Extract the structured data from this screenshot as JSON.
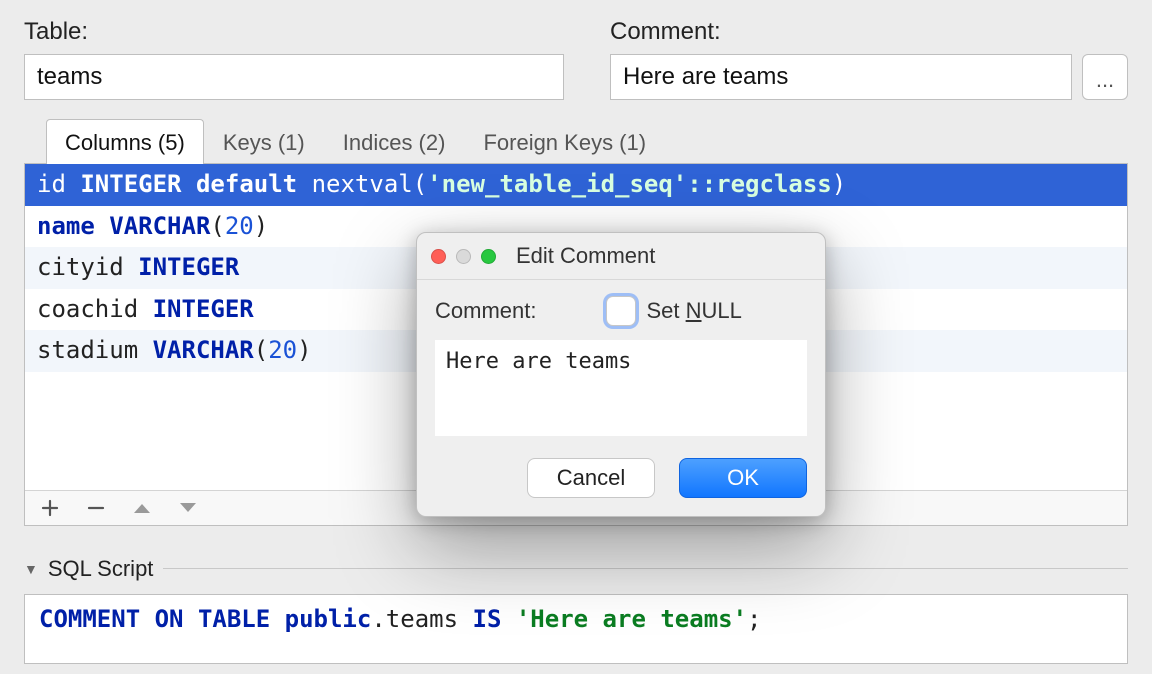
{
  "top": {
    "table_label": "Table:",
    "table_value": "teams",
    "comment_label": "Comment:",
    "comment_value": "Here are teams",
    "ellipsis": "..."
  },
  "tabs": [
    {
      "label": "Columns (5)",
      "active": true
    },
    {
      "label": "Keys (1)",
      "active": false
    },
    {
      "label": "Indices (2)",
      "active": false
    },
    {
      "label": "Foreign Keys (1)",
      "active": false
    }
  ],
  "columns": [
    {
      "name": "id",
      "type": "INTEGER",
      "extra_kw": "default",
      "extra_fn": "nextval(",
      "extra_str": "'new_table_id_seq'::regclass",
      "extra_close": ")",
      "selected": true
    },
    {
      "name": "name",
      "type": "VARCHAR",
      "size": "20"
    },
    {
      "name": "cityid",
      "type": "INTEGER",
      "alt": true
    },
    {
      "name": "coachid",
      "type": "INTEGER"
    },
    {
      "name": "stadium",
      "type": "VARCHAR",
      "size": "20",
      "alt": true
    }
  ],
  "sql": {
    "header": "SQL Script",
    "kw1": "COMMENT ON TABLE public",
    "ident": ".teams ",
    "kw2": "IS ",
    "str": "'Here are teams'",
    "term": ";"
  },
  "modal": {
    "title": "Edit Comment",
    "comment_label": "Comment:",
    "set_null_pre": "Set ",
    "set_null_ul": "N",
    "set_null_post": "ULL",
    "text": "Here are teams",
    "cancel": "Cancel",
    "ok": "OK"
  }
}
